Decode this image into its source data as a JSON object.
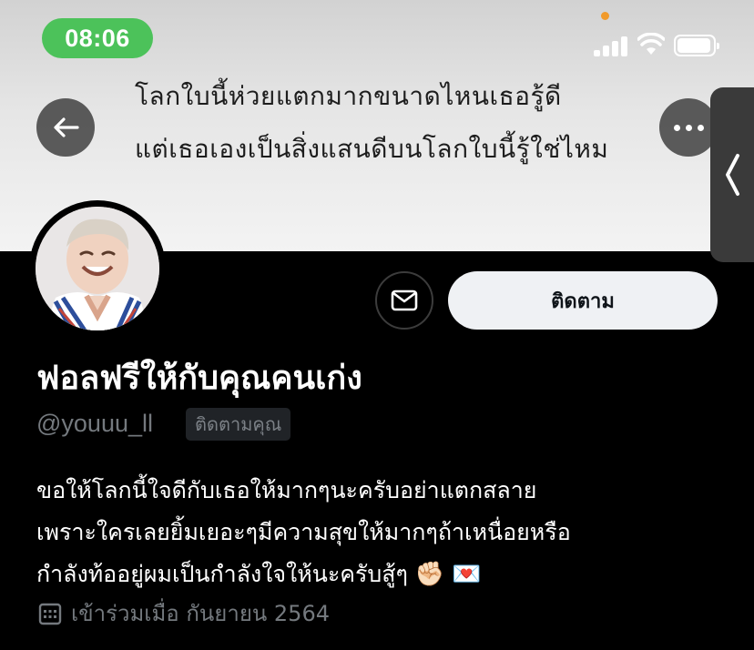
{
  "status_bar": {
    "time": "08:06"
  },
  "banner": {
    "line1": "โลกใบนี้ห่วยแตกมากขนาดไหนเธอรู้ดี",
    "line2": "แต่เธอเองเป็นสิ่งแสนดีบนโลกใบนี้รู้ใช่ไหม"
  },
  "actions": {
    "follow_label": "ติดตาม"
  },
  "profile": {
    "display_name": "ฟอลฟรีให้กับคุณคนเก่ง",
    "handle": "@youuu_ll",
    "follows_you_badge": "ติดตามคุณ",
    "bio_lines": [
      "ขอให้โลกนี้ใจดีกับเธอให้มากๆนะครับอย่าแตกสลาย",
      "เพราะใครเลยยิ้มเยอะๆมีความสุขให้มากๆถ้าเหนื่อยหรือ",
      "กำลังท้ออยู่ผมเป็นกำลังใจให้นะครับสู้ๆ"
    ],
    "bio_emojis": [
      "✊🏻",
      "💌"
    ],
    "joined": "เข้าร่วมเมื่อ กันยายน 2564"
  },
  "colors": {
    "time_pill": "#4cc25a",
    "background": "#000000",
    "follow_button_bg": "#eff1f4",
    "muted_text": "#74797e"
  },
  "icons": [
    "back-arrow-icon",
    "more-icon",
    "mail-icon",
    "calendar-icon",
    "signal-icon",
    "wifi-icon",
    "battery-icon",
    "chevron-left-icon"
  ]
}
